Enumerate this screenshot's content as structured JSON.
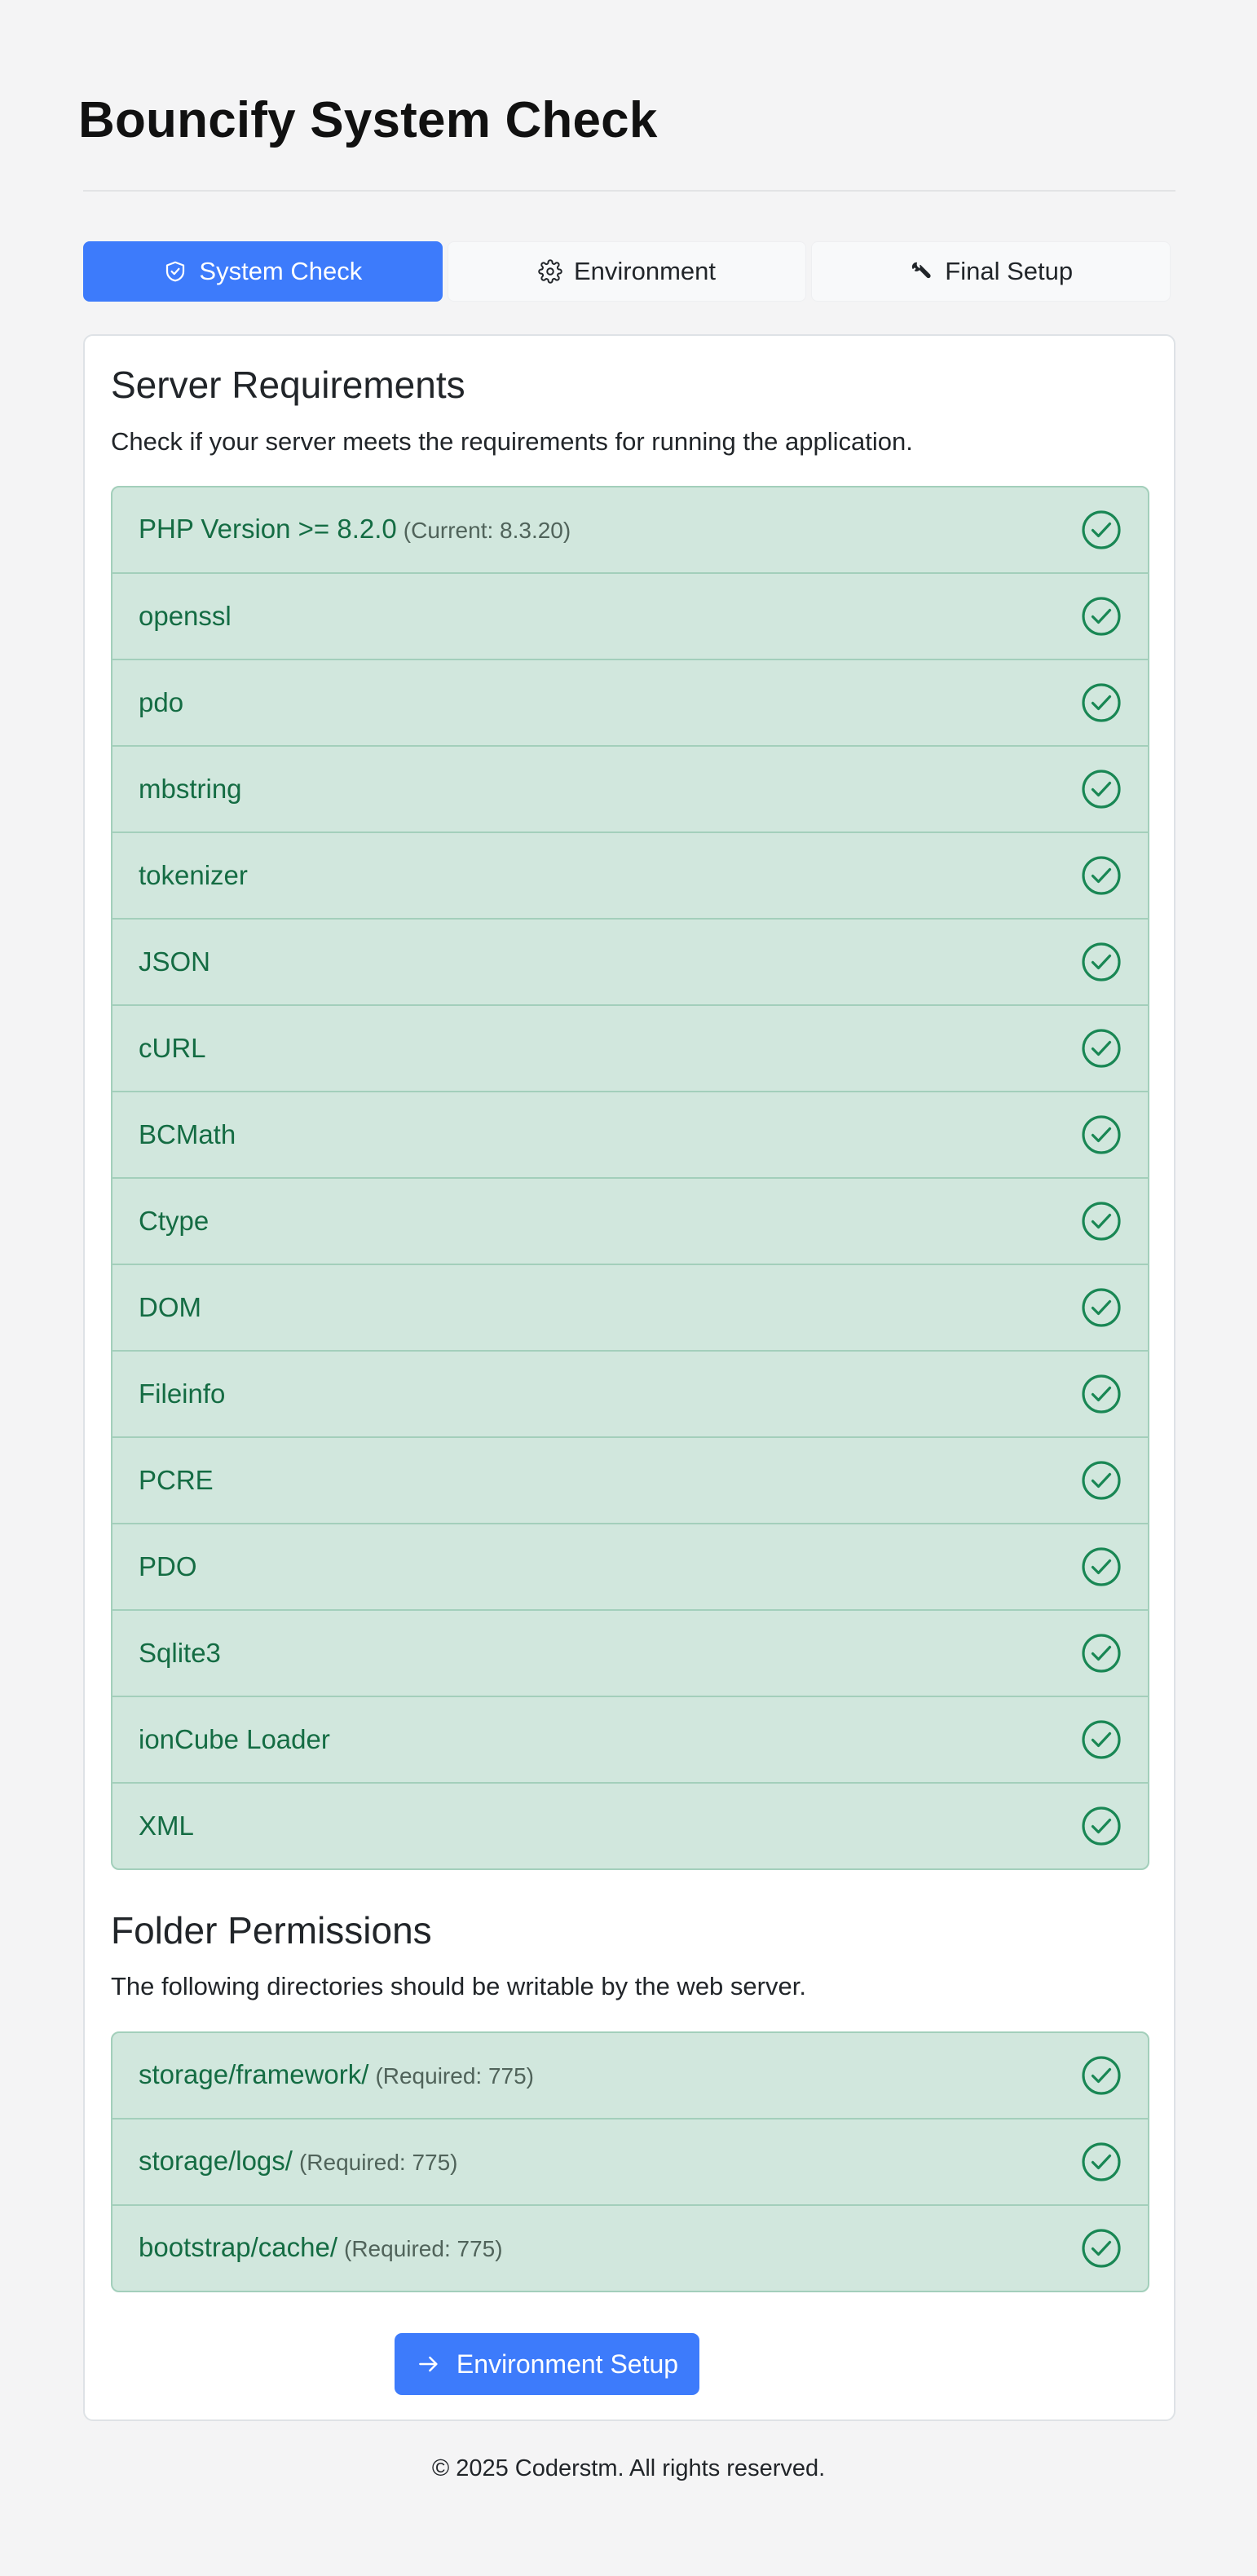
{
  "header": {
    "title": "Bouncify System Check"
  },
  "tabs": [
    {
      "label": "System Check",
      "icon": "shield-check-icon",
      "active": true
    },
    {
      "label": "Environment",
      "icon": "gear-icon",
      "active": false
    },
    {
      "label": "Final Setup",
      "icon": "wrench-icon",
      "active": false
    }
  ],
  "requirements": {
    "title": "Server Requirements",
    "description": "Check if your server meets the requirements for running the application.",
    "items": [
      {
        "label": "PHP Version >= 8.2.0",
        "detail": "(Current: 8.3.20)",
        "status": "passed"
      },
      {
        "label": "openssl",
        "status": "passed"
      },
      {
        "label": "pdo",
        "status": "passed"
      },
      {
        "label": "mbstring",
        "status": "passed"
      },
      {
        "label": "tokenizer",
        "status": "passed"
      },
      {
        "label": "JSON",
        "status": "passed"
      },
      {
        "label": "cURL",
        "status": "passed"
      },
      {
        "label": "BCMath",
        "status": "passed"
      },
      {
        "label": "Ctype",
        "status": "passed"
      },
      {
        "label": "DOM",
        "status": "passed"
      },
      {
        "label": "Fileinfo",
        "status": "passed"
      },
      {
        "label": "PCRE",
        "status": "passed"
      },
      {
        "label": "PDO",
        "status": "passed"
      },
      {
        "label": "Sqlite3",
        "status": "passed"
      },
      {
        "label": "ionCube Loader",
        "status": "passed"
      },
      {
        "label": "XML",
        "status": "passed"
      }
    ]
  },
  "permissions": {
    "title": "Folder Permissions",
    "description": "The following directories should be writable by the web server.",
    "items": [
      {
        "label": "storage/framework/",
        "detail": "(Required: 775)",
        "status": "passed"
      },
      {
        "label": "storage/logs/",
        "detail": "(Required: 775)",
        "status": "passed"
      },
      {
        "label": "bootstrap/cache/",
        "detail": "(Required: 775)",
        "status": "passed"
      }
    ]
  },
  "actions": {
    "next_label": "Environment Setup",
    "next_icon": "arrow-right-icon"
  },
  "footer": {
    "text": "© 2025 Coderstm. All rights reserved."
  },
  "colors": {
    "primary": "#3d7bfb",
    "success_bg": "#d1e7dd",
    "success_border": "#a3cfbb",
    "success_text": "#146c43",
    "page_bg": "#f4f4f5"
  }
}
